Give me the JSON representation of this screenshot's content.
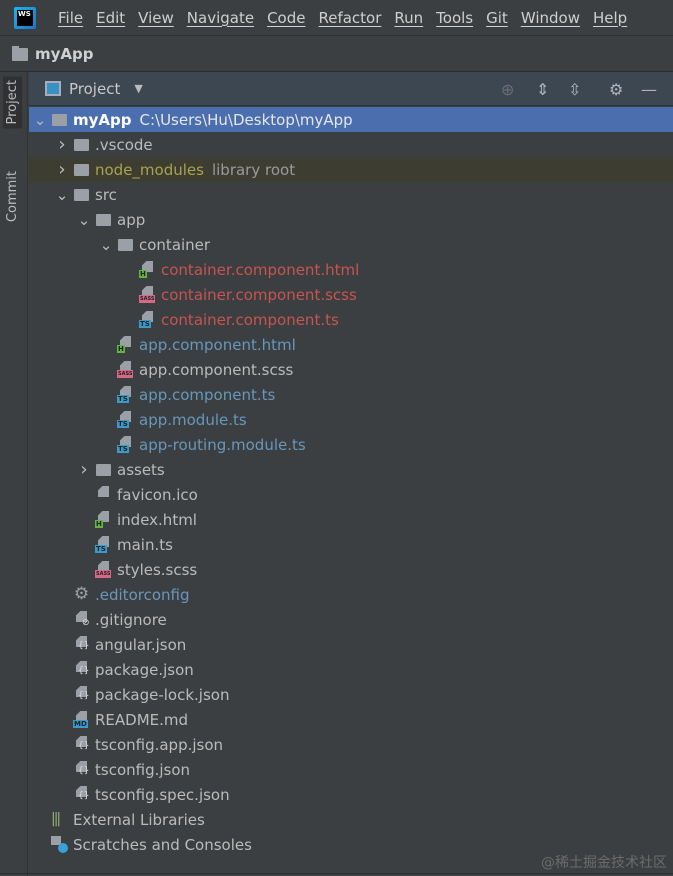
{
  "menu": [
    "File",
    "Edit",
    "View",
    "Navigate",
    "Code",
    "Refactor",
    "Run",
    "Tools",
    "Git",
    "Window",
    "Help"
  ],
  "logo": "WS",
  "breadcrumb": "myApp",
  "side_tabs": {
    "project": "Project",
    "commit": "Commit"
  },
  "panel": {
    "title": "Project"
  },
  "colors": {
    "modified": "#6897bb",
    "new": "#c75450",
    "normal": "#bbbbbb",
    "library": "#a8a34e",
    "selection": "#4b6eaf"
  },
  "tree": [
    {
      "level": 0,
      "arrow": "open",
      "icon": "folder",
      "name": "myApp",
      "suffix": "C:\\Users\\Hu\\Desktop\\myApp",
      "bold": true,
      "selected": true
    },
    {
      "level": 1,
      "arrow": "closed",
      "icon": "folder",
      "name": ".vscode"
    },
    {
      "level": 1,
      "arrow": "closed",
      "icon": "folder",
      "name": "node_modules",
      "suffix": "library root",
      "status": "library"
    },
    {
      "level": 1,
      "arrow": "open",
      "icon": "folder",
      "name": "src"
    },
    {
      "level": 2,
      "arrow": "open",
      "icon": "folder",
      "name": "app"
    },
    {
      "level": 3,
      "arrow": "open",
      "icon": "folder",
      "name": "container"
    },
    {
      "level": 4,
      "icon": "html",
      "name": "container.component.html",
      "status": "new"
    },
    {
      "level": 4,
      "icon": "sass",
      "name": "container.component.scss",
      "status": "new"
    },
    {
      "level": 4,
      "icon": "ts",
      "name": "container.component.ts",
      "status": "new"
    },
    {
      "level": 3,
      "icon": "html",
      "name": "app.component.html",
      "status": "modified"
    },
    {
      "level": 3,
      "icon": "sass",
      "name": "app.component.scss"
    },
    {
      "level": 3,
      "icon": "ts",
      "name": "app.component.ts",
      "status": "modified"
    },
    {
      "level": 3,
      "icon": "ts",
      "name": "app.module.ts",
      "status": "modified"
    },
    {
      "level": 3,
      "icon": "ts",
      "name": "app-routing.module.ts",
      "status": "modified"
    },
    {
      "level": 2,
      "arrow": "closed",
      "icon": "folder",
      "name": "assets"
    },
    {
      "level": 2,
      "icon": "file",
      "name": "favicon.ico"
    },
    {
      "level": 2,
      "icon": "html",
      "name": "index.html"
    },
    {
      "level": 2,
      "icon": "ts",
      "name": "main.ts"
    },
    {
      "level": 2,
      "icon": "sass",
      "name": "styles.scss"
    },
    {
      "level": 1,
      "icon": "gear",
      "name": ".editorconfig",
      "status": "modified"
    },
    {
      "level": 1,
      "icon": "ignore",
      "name": ".gitignore"
    },
    {
      "level": 1,
      "icon": "json",
      "name": "angular.json"
    },
    {
      "level": 1,
      "icon": "json",
      "name": "package.json"
    },
    {
      "level": 1,
      "icon": "json",
      "name": "package-lock.json"
    },
    {
      "level": 1,
      "icon": "md",
      "name": "README.md"
    },
    {
      "level": 1,
      "icon": "json",
      "name": "tsconfig.app.json"
    },
    {
      "level": 1,
      "icon": "json",
      "name": "tsconfig.json"
    },
    {
      "level": 1,
      "icon": "json",
      "name": "tsconfig.spec.json"
    },
    {
      "level": 0,
      "icon": "libs",
      "name": "External Libraries"
    },
    {
      "level": 0,
      "icon": "scratch",
      "name": "Scratches and Consoles"
    }
  ],
  "watermark": "@稀土掘金技术社区"
}
